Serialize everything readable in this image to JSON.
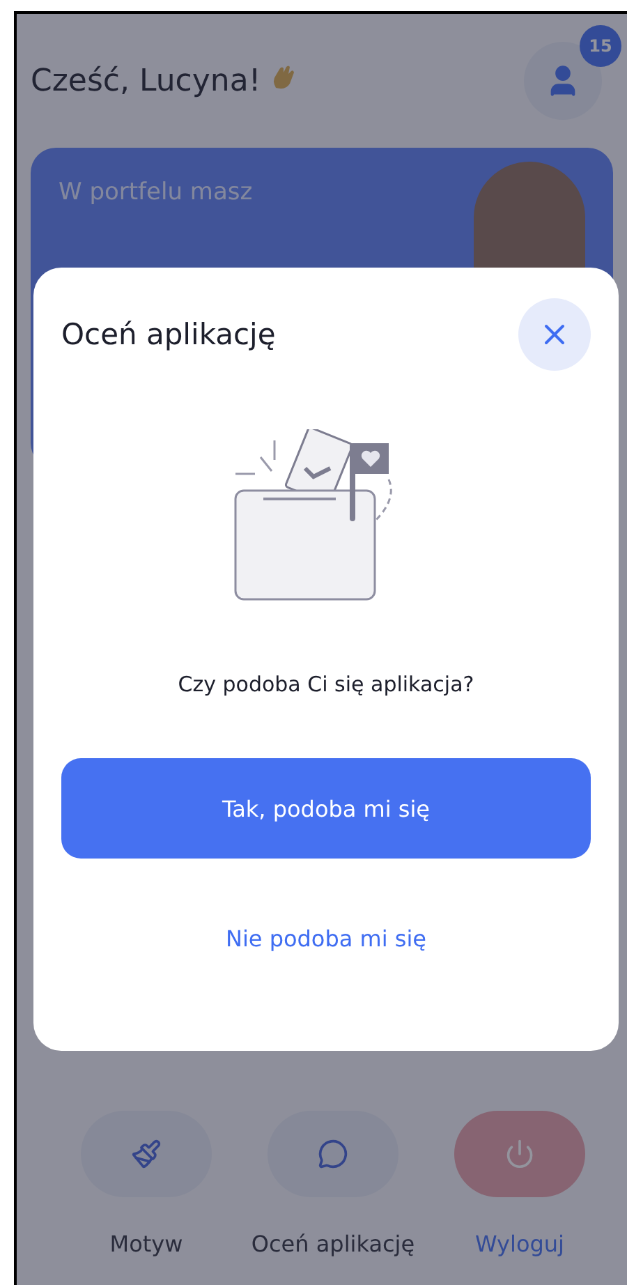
{
  "header": {
    "greeting": "Cześć, Lucyna!",
    "badge": "15"
  },
  "wallet": {
    "label": "W portfelu masz"
  },
  "actions": [
    {
      "kind": "theme",
      "label": "Motyw"
    },
    {
      "kind": "rate",
      "label": "Oceń aplikację"
    },
    {
      "kind": "logout",
      "label": "Wyloguj"
    }
  ],
  "modal": {
    "title": "Oceń aplikację",
    "question": "Czy podoba Ci się aplikacja?",
    "primary_button": "Tak, podoba mi się",
    "secondary_link": "Nie podoba mi się"
  }
}
